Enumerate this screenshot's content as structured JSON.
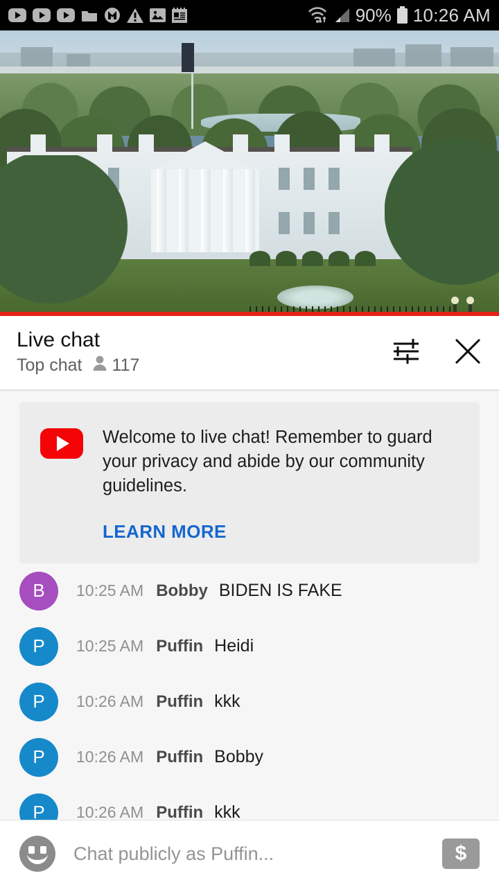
{
  "status_bar": {
    "icons": [
      "youtube-play-icon",
      "youtube-play-icon",
      "youtube-play-icon",
      "folder-icon",
      "m-circle-icon",
      "warning-triangle-icon",
      "gallery-image-icon",
      "notes-icon"
    ],
    "wifi_icon": "wifi-data-transfer-icon",
    "signal_icon": "cell-signal-icon",
    "battery_percent": "90%",
    "battery_icon": "battery-icon",
    "time": "10:26 AM"
  },
  "video": {
    "description": "White House live stream",
    "progress_color": "#e62117"
  },
  "chat_header": {
    "title": "Live chat",
    "subtitle": "Top chat",
    "viewer_icon": "person-icon",
    "viewer_count": "117",
    "filter_icon": "tune-filter-icon",
    "close_icon": "close-x-icon"
  },
  "welcome_card": {
    "logo": "youtube-logo-icon",
    "text": "Welcome to live chat! Remember to guard your privacy and abide by our community guidelines.",
    "learn_more": "LEARN MORE",
    "learn_more_color": "#1667cf"
  },
  "messages": [
    {
      "initial": "B",
      "avatar_color": "#a64dbf",
      "time": "10:25 AM",
      "author": "Bobby",
      "text": "BIDEN IS FAKE"
    },
    {
      "initial": "P",
      "avatar_color": "#1689ca",
      "time": "10:25 AM",
      "author": "Puffin",
      "text": "Heidi"
    },
    {
      "initial": "P",
      "avatar_color": "#1689ca",
      "time": "10:26 AM",
      "author": "Puffin",
      "text": "kkk"
    },
    {
      "initial": "P",
      "avatar_color": "#1689ca",
      "time": "10:26 AM",
      "author": "Puffin",
      "text": "Bobby"
    },
    {
      "initial": "P",
      "avatar_color": "#1689ca",
      "time": "10:26 AM",
      "author": "Puffin",
      "text": "kkk"
    }
  ],
  "composer": {
    "emoji_icon": "emoji-smiley-icon",
    "placeholder": "Chat publicly as Puffin...",
    "superchat_icon": "dollar-superchat-icon",
    "superchat_symbol": "$"
  }
}
